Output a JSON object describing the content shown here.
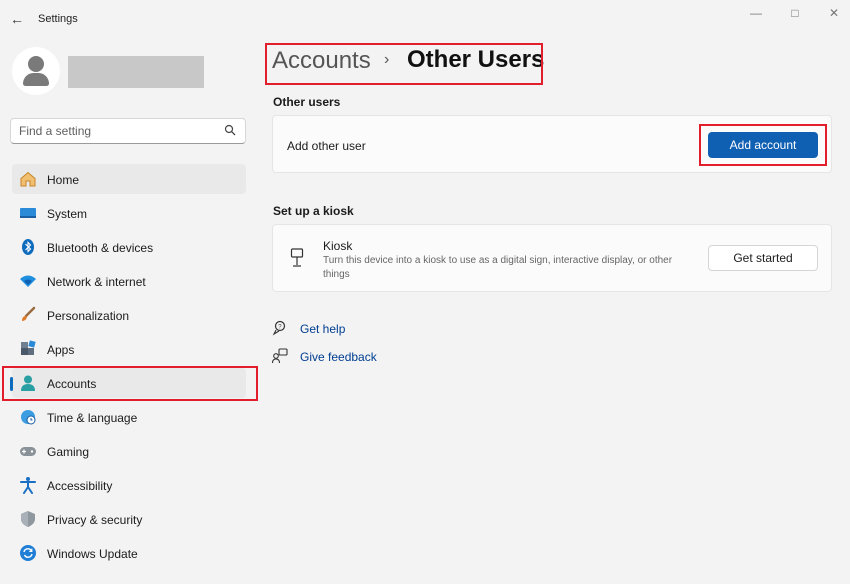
{
  "window": {
    "title": "Settings"
  },
  "search": {
    "placeholder": "Find a setting"
  },
  "sidebar": {
    "items": [
      {
        "label": "Home"
      },
      {
        "label": "System"
      },
      {
        "label": "Bluetooth & devices"
      },
      {
        "label": "Network & internet"
      },
      {
        "label": "Personalization"
      },
      {
        "label": "Apps"
      },
      {
        "label": "Accounts"
      },
      {
        "label": "Time & language"
      },
      {
        "label": "Gaming"
      },
      {
        "label": "Accessibility"
      },
      {
        "label": "Privacy & security"
      },
      {
        "label": "Windows Update"
      }
    ]
  },
  "breadcrumb": {
    "parent": "Accounts",
    "separator": "›",
    "current": "Other Users"
  },
  "other_users": {
    "heading": "Other users",
    "row_label": "Add other user",
    "button": "Add account"
  },
  "kiosk": {
    "heading": "Set up a kiosk",
    "title": "Kiosk",
    "description_line1": "Turn this device into a kiosk to use as a digital sign, interactive display, or other",
    "description_line2": "things",
    "button": "Get started"
  },
  "links": {
    "help": "Get help",
    "feedback": "Give feedback"
  },
  "colors": {
    "accent": "#0f5fb3",
    "highlight": "#e21d2c"
  }
}
